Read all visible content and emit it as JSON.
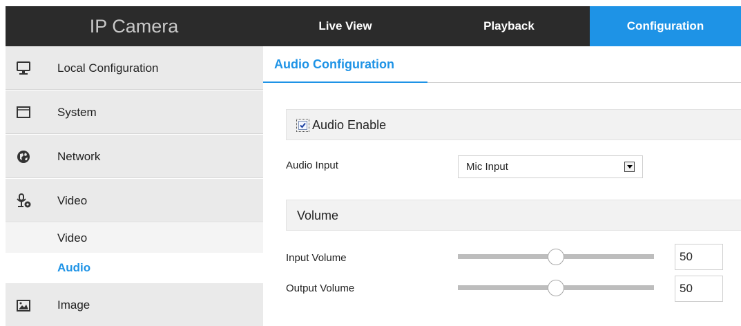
{
  "header": {
    "brand": "IP Camera",
    "tabs": [
      {
        "label": "Live View"
      },
      {
        "label": "Playback"
      },
      {
        "label": "Configuration",
        "active": true
      }
    ]
  },
  "sidebar": {
    "items": [
      {
        "label": "Local Configuration",
        "icon": "monitor-icon"
      },
      {
        "label": "System",
        "icon": "window-icon"
      },
      {
        "label": "Network",
        "icon": "globe-icon"
      },
      {
        "label": "Video",
        "icon": "microphone-camera-icon"
      }
    ],
    "subitems": [
      {
        "label": "Video"
      },
      {
        "label": "Audio",
        "active": true
      }
    ],
    "after_items": [
      {
        "label": "Image",
        "icon": "image-icon"
      }
    ]
  },
  "main": {
    "tab": "Audio Configuration",
    "audio_enable": {
      "label": "Audio Enable",
      "checked": true
    },
    "audio_input": {
      "label": "Audio Input",
      "value": "Mic Input"
    },
    "volume_section": "Volume",
    "input_volume": {
      "label": "Input Volume",
      "value": "50",
      "level": 0.5
    },
    "output_volume": {
      "label": "Output Volume",
      "value": "50",
      "level": 0.5
    }
  },
  "colors": {
    "accent": "#1e93e6",
    "topbar": "#2b2b2b",
    "sidebar_item": "#eaeaea"
  }
}
